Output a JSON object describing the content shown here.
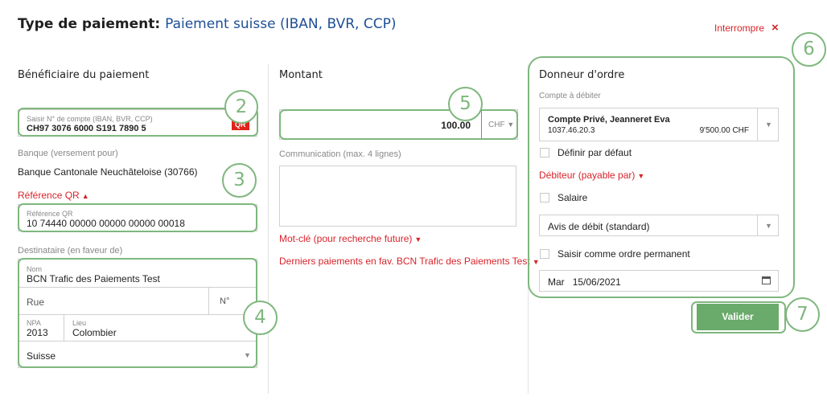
{
  "header": {
    "title_label": "Type de paiement:",
    "title_value": "Paiement suisse (IBAN, BVR, CCP)",
    "interrupt_label": "Interrompre",
    "interrupt_icon": "×"
  },
  "beneficiary": {
    "heading": "Bénéficiaire du paiement",
    "account_label": "Saisir N° de compte (IBAN, BVR, CCP)",
    "account_value": "CH97 3076 6000 S191 7890 5",
    "qr_badge": "QR",
    "bank_label": "Banque (versement pour)",
    "bank_value": "Banque Cantonale Neuchâteloise (30766)",
    "ref_toggle": "Référence QR",
    "ref_label": "Référence QR",
    "ref_value": "10 74440 00000 00000 00000 00018",
    "recipient_label": "Destinataire (en faveur de)",
    "name_label": "Nom",
    "name_value": "BCN Trafic des Paiements Test",
    "street_placeholder": "Rue",
    "number_placeholder": "N°",
    "npa_label": "NPA",
    "npa_value": "2013",
    "city_label": "Lieu",
    "city_value": "Colombier",
    "country_value": "Suisse"
  },
  "amount": {
    "heading": "Montant",
    "value": "100.00",
    "currency": "CHF",
    "communication_label": "Communication (max. 4 lignes)",
    "keyword_link": "Mot-clé (pour recherche future)",
    "last_payments_link": "Derniers paiements en fav. BCN Trafic des Paiements Test"
  },
  "ordering": {
    "heading": "Donneur d'ordre",
    "debit_account_label": "Compte à débiter",
    "account_name": "Compte Privé, Jeanneret Eva",
    "account_number": "1037.46.20.3",
    "account_balance": "9'500.00 CHF",
    "default_label": "Définir par défaut",
    "debtor_link": "Débiteur (payable par)",
    "salary_label": "Salaire",
    "debit_notice": "Avis de débit (standard)",
    "standing_order_label": "Saisir comme ordre permanent",
    "date_day": "Mar",
    "date_value": "15/06/2021",
    "submit_label": "Valider"
  },
  "markers": [
    "2",
    "3",
    "4",
    "5",
    "6",
    "7"
  ],
  "colors": {
    "accent_red": "#d8232a",
    "title_blue": "#1e4f94",
    "highlight_green": "#7fb77e",
    "button_green": "#6aaa6a"
  }
}
